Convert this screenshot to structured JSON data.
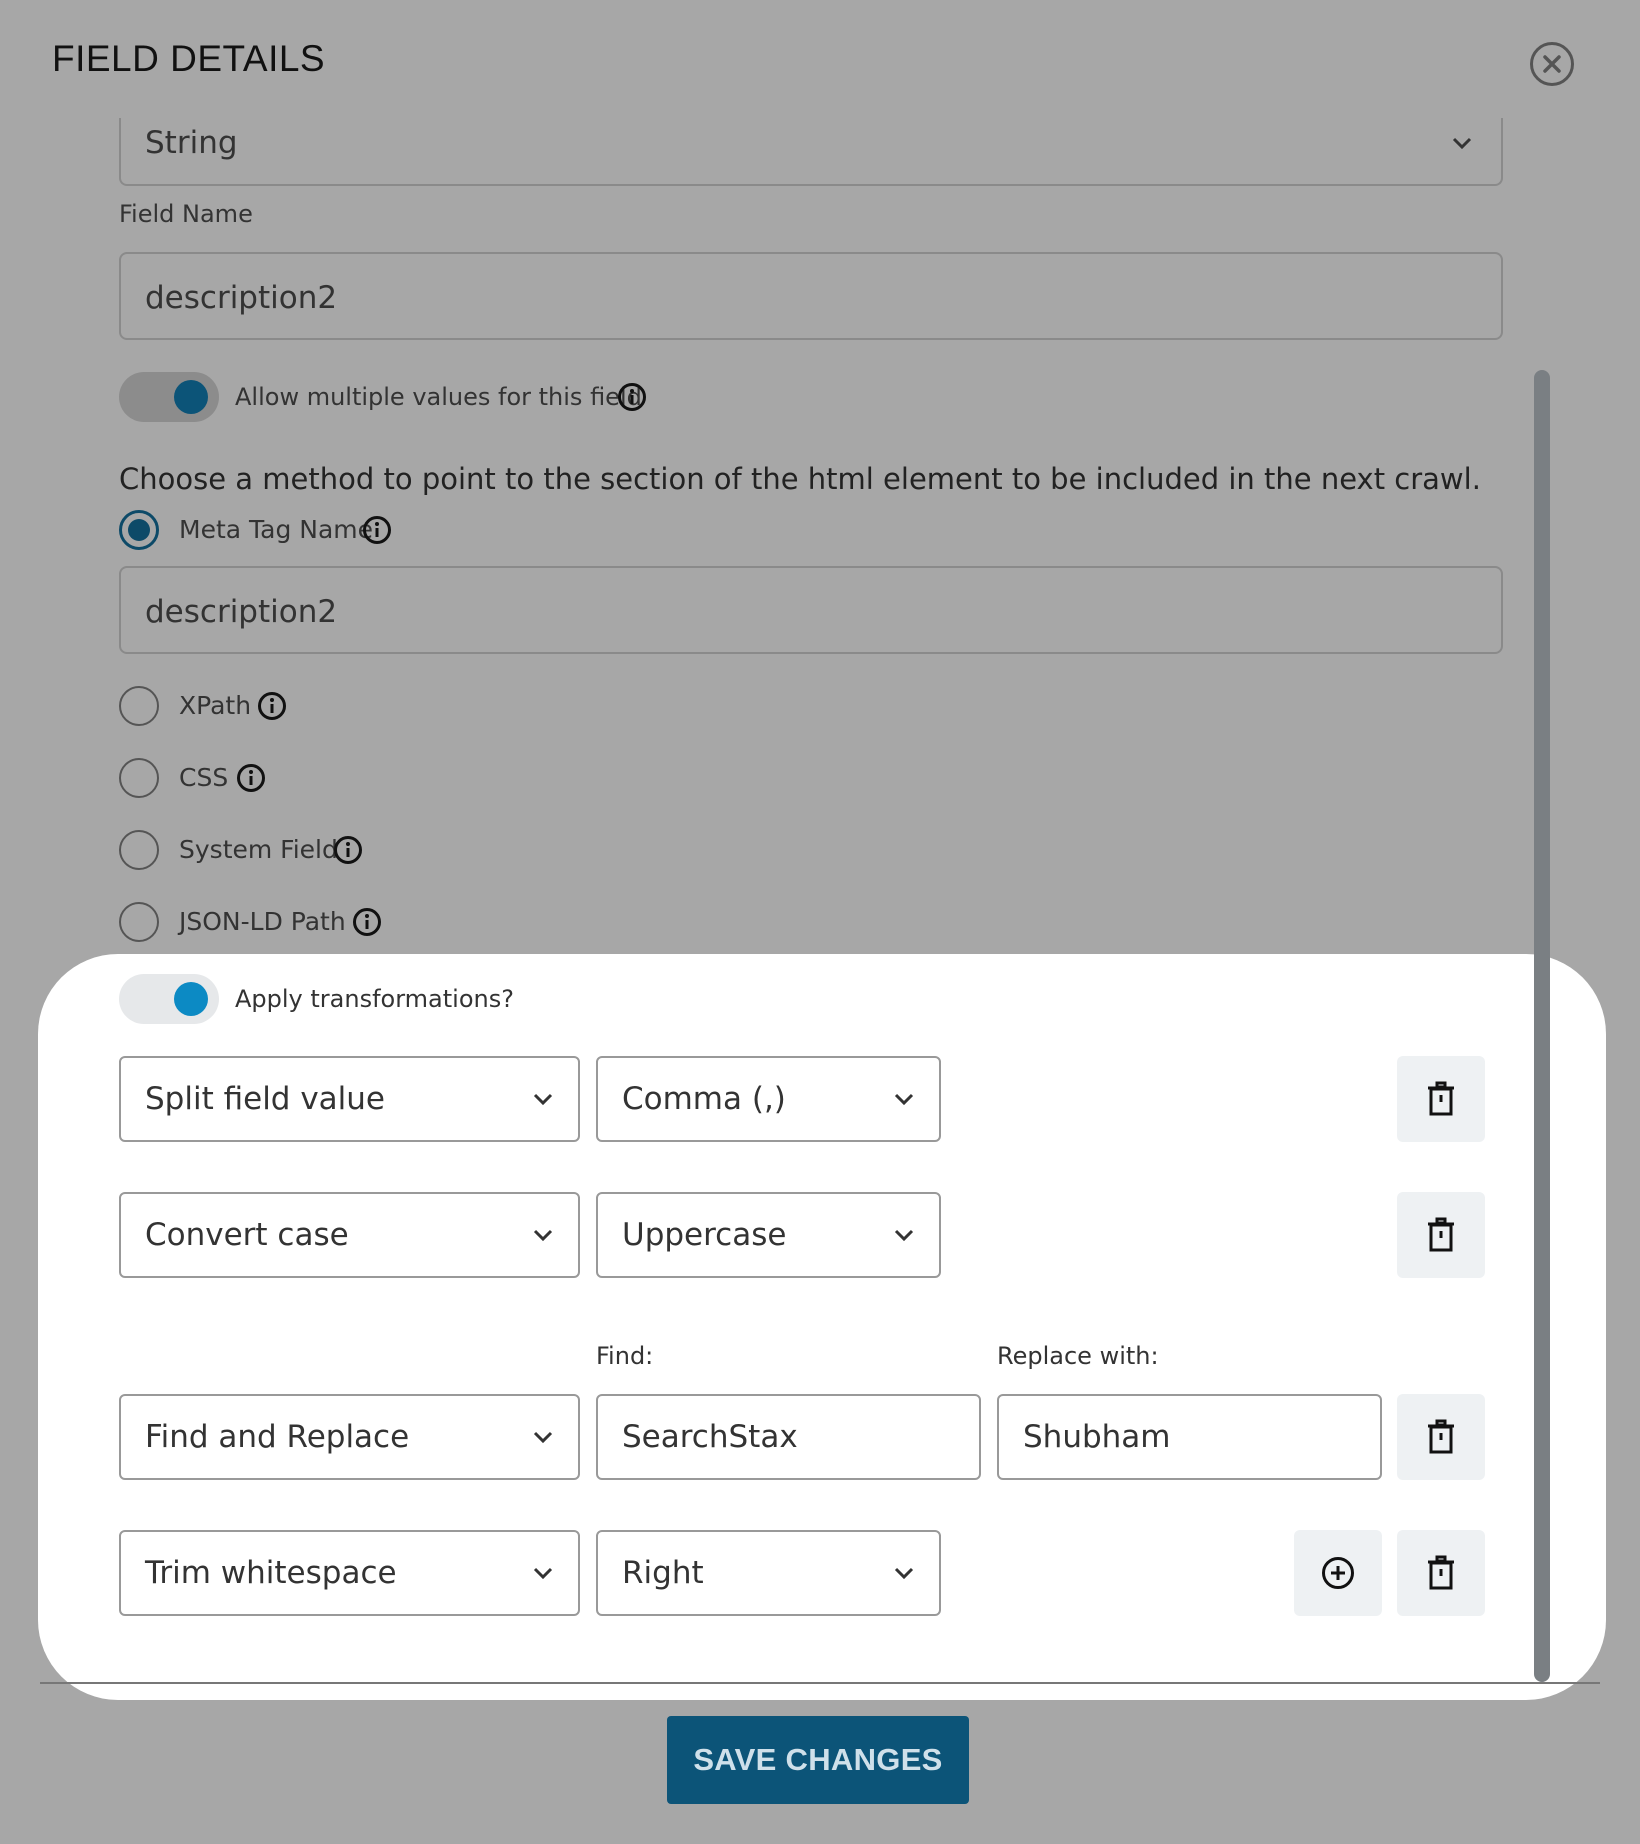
{
  "dialog": {
    "title": "FIELD DETAILS"
  },
  "type_select": {
    "value": "String"
  },
  "field_name": {
    "label": "Field Name",
    "value": "description2"
  },
  "multi_toggle": {
    "label": "Allow multiple values for this field",
    "on": true
  },
  "method": {
    "prompt": "Choose a method to point to the section of the html element to be included in the next crawl.",
    "options": [
      {
        "label": "Meta Tag Name",
        "selected": true
      },
      {
        "label": "XPath",
        "selected": false
      },
      {
        "label": "CSS",
        "selected": false
      },
      {
        "label": "System Field",
        "selected": false
      },
      {
        "label": "JSON-LD Path",
        "selected": false
      }
    ],
    "meta_tag_value": "description2"
  },
  "transform_toggle": {
    "label": "Apply transformations?",
    "on": true
  },
  "transformations": [
    {
      "type": "Split field value",
      "option": "Comma (,)"
    },
    {
      "type": "Convert case",
      "option": "Uppercase"
    },
    {
      "type": "Find and Replace",
      "find_label": "Find:",
      "find_value": "SearchStax",
      "replace_label": "Replace with:",
      "replace_value": "Shubham"
    },
    {
      "type": "Trim whitespace",
      "option": "Right"
    }
  ],
  "footer": {
    "save_label": "SAVE CHANGES"
  },
  "colors": {
    "overlay": "#a7a7a7",
    "primary": "#0c5478",
    "toggle_knob": "#0c8ac4",
    "panel": "#ffffff"
  }
}
